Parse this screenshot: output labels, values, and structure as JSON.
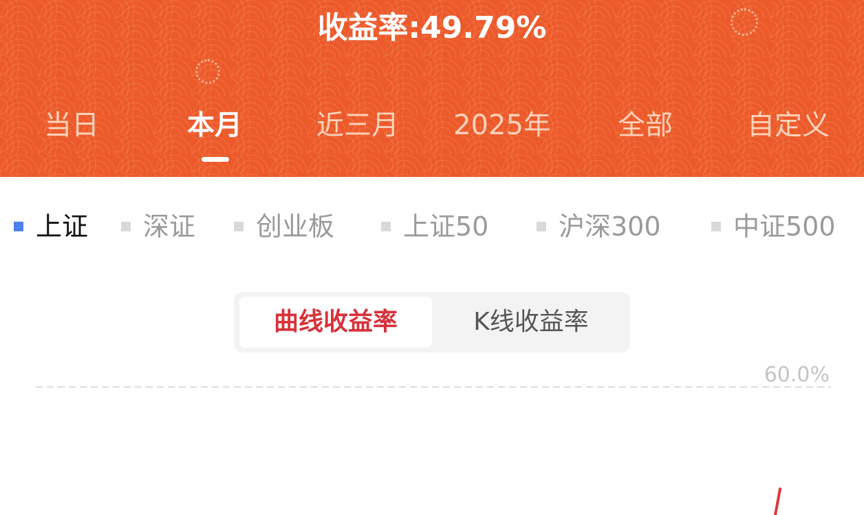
{
  "header": {
    "return_text": "收益率:49.79%"
  },
  "period_tabs": [
    {
      "label": "当日",
      "active": false
    },
    {
      "label": "本月",
      "active": true
    },
    {
      "label": "近三月",
      "active": false
    },
    {
      "label": "2025年",
      "active": false
    },
    {
      "label": "全部",
      "active": false
    },
    {
      "label": "自定义",
      "active": false
    }
  ],
  "index_legend": [
    {
      "label": "上证",
      "color": "#4e80ee",
      "selected": true
    },
    {
      "label": "深证",
      "color": "#d9d9d9",
      "selected": false
    },
    {
      "label": "创业板",
      "color": "#d9d9d9",
      "selected": false
    },
    {
      "label": "上证50",
      "color": "#d9d9d9",
      "selected": false
    },
    {
      "label": "沪深300",
      "color": "#d9d9d9",
      "selected": false
    },
    {
      "label": "中证500",
      "color": "#d9d9d9",
      "selected": false
    }
  ],
  "chart_mode": {
    "options": [
      "曲线收益率",
      "K线收益率"
    ],
    "selected": "曲线收益率"
  },
  "colors": {
    "brand_orange": "#ec5a2c",
    "active_red": "#d8323a",
    "series_line": "#e0363c"
  },
  "chart_data": {
    "type": "line",
    "y_tick_labels": [
      "60.0%"
    ],
    "grid": true
  }
}
